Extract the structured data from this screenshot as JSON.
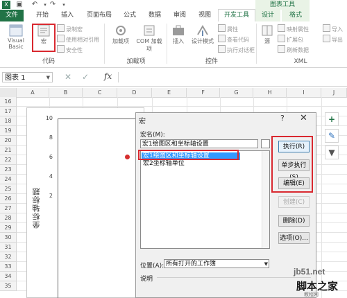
{
  "titlebar": {
    "contextual_group": "图表工具"
  },
  "tabs": [
    {
      "label": "文件"
    },
    {
      "label": "开始"
    },
    {
      "label": "插入"
    },
    {
      "label": "页面布局"
    },
    {
      "label": "公式"
    },
    {
      "label": "数据"
    },
    {
      "label": "审阅"
    },
    {
      "label": "视图"
    },
    {
      "label": "开发工具"
    },
    {
      "label": "设计"
    },
    {
      "label": "格式"
    }
  ],
  "ribbon": {
    "code": {
      "visual_basic": "Visual Basic",
      "macro": "宏",
      "record_macro": "录制宏",
      "relative_ref": "使用相对引用",
      "macro_security": "安全性",
      "group_label": "代码"
    },
    "addins": {
      "addins": "加载项",
      "com_addins": "COM 加载项",
      "group_label": "加载项"
    },
    "controls": {
      "insert": "插入",
      "design_mode": "设计模式",
      "properties": "属性",
      "view_code": "查看代码",
      "run_dialog": "执行对话框",
      "group_label": "控件"
    },
    "xml": {
      "source": "源",
      "map_properties": "映射属性",
      "expansion_packs": "扩展包",
      "refresh_data": "刷新数据",
      "import": "导入",
      "export": "导出",
      "group_label": "XML"
    }
  },
  "formula_bar": {
    "name_box": "图表 1",
    "cancel_glyph": "✕",
    "enter_glyph": "✓",
    "fx": "fx"
  },
  "columns": [
    "A",
    "B",
    "C",
    "D",
    "E",
    "F",
    "G",
    "H",
    "I",
    "J"
  ],
  "rows": [
    "16",
    "17",
    "18",
    "19",
    "20",
    "21",
    "22",
    "23",
    "24",
    "25",
    "26",
    "27",
    "28",
    "29",
    "30",
    "31",
    "32",
    "33",
    "34",
    "35"
  ],
  "chart": {
    "y_axis_title": "坐标轴标题",
    "y_ticks": [
      "10",
      "8",
      "6",
      "4",
      "2"
    ],
    "point_color": "#d62f2f"
  },
  "dialog": {
    "title": "宏",
    "help": "?",
    "close": "✕",
    "macro_name_label": "宏名(M):",
    "macro_name_value": "宏1绘图区和坐标轴设置",
    "macro_list": [
      "宏1绘图区和坐标轴设置",
      "宏2坐标轴单位"
    ],
    "buttons": {
      "run": "执行(R)",
      "step_into": "单步执行(S)",
      "edit": "编辑(E)",
      "create": "创建(C)",
      "delete": "删除(D)",
      "options": "选项(O)..."
    },
    "location_label": "位置(A):",
    "location_value": "所有打开的工作簿",
    "description_label": "说明"
  },
  "watermark": {
    "site": "jb51.net",
    "name": "脚本之家",
    "caption": "教程网"
  },
  "colors": {
    "excel_green": "#217346",
    "highlight_red": "#d9282f",
    "selection_blue": "#3399ff"
  }
}
